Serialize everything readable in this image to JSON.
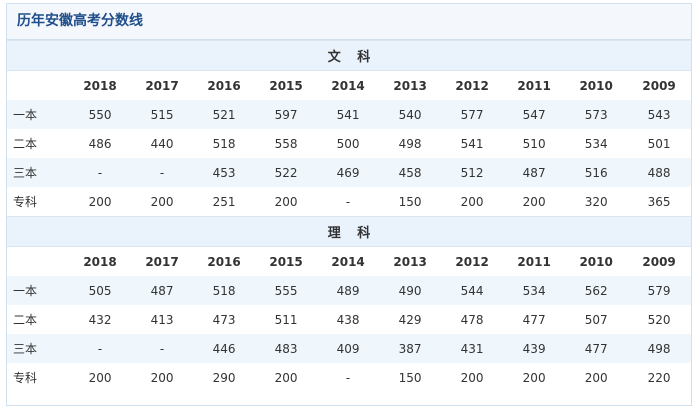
{
  "title": "历年安徽高考分数线",
  "sections": [
    {
      "name": "文 科",
      "years": [
        "2018",
        "2017",
        "2016",
        "2015",
        "2014",
        "2013",
        "2012",
        "2011",
        "2010",
        "2009"
      ],
      "rows": [
        {
          "label": "一本",
          "values": [
            "550",
            "515",
            "521",
            "597",
            "541",
            "540",
            "577",
            "547",
            "573",
            "543"
          ]
        },
        {
          "label": "二本",
          "values": [
            "486",
            "440",
            "518",
            "558",
            "500",
            "498",
            "541",
            "510",
            "534",
            "501"
          ]
        },
        {
          "label": "三本",
          "values": [
            "-",
            "-",
            "453",
            "522",
            "469",
            "458",
            "512",
            "487",
            "516",
            "488"
          ]
        },
        {
          "label": "专科",
          "values": [
            "200",
            "200",
            "251",
            "200",
            "-",
            "150",
            "200",
            "200",
            "320",
            "365"
          ]
        }
      ]
    },
    {
      "name": "理 科",
      "years": [
        "2018",
        "2017",
        "2016",
        "2015",
        "2014",
        "2013",
        "2012",
        "2011",
        "2010",
        "2009"
      ],
      "rows": [
        {
          "label": "一本",
          "values": [
            "505",
            "487",
            "518",
            "555",
            "489",
            "490",
            "544",
            "534",
            "562",
            "579"
          ]
        },
        {
          "label": "二本",
          "values": [
            "432",
            "413",
            "473",
            "511",
            "438",
            "429",
            "478",
            "477",
            "507",
            "520"
          ]
        },
        {
          "label": "三本",
          "values": [
            "-",
            "-",
            "446",
            "483",
            "409",
            "387",
            "431",
            "439",
            "477",
            "498"
          ]
        },
        {
          "label": "专科",
          "values": [
            "200",
            "200",
            "290",
            "200",
            "-",
            "150",
            "200",
            "200",
            "200",
            "220"
          ]
        }
      ]
    }
  ]
}
